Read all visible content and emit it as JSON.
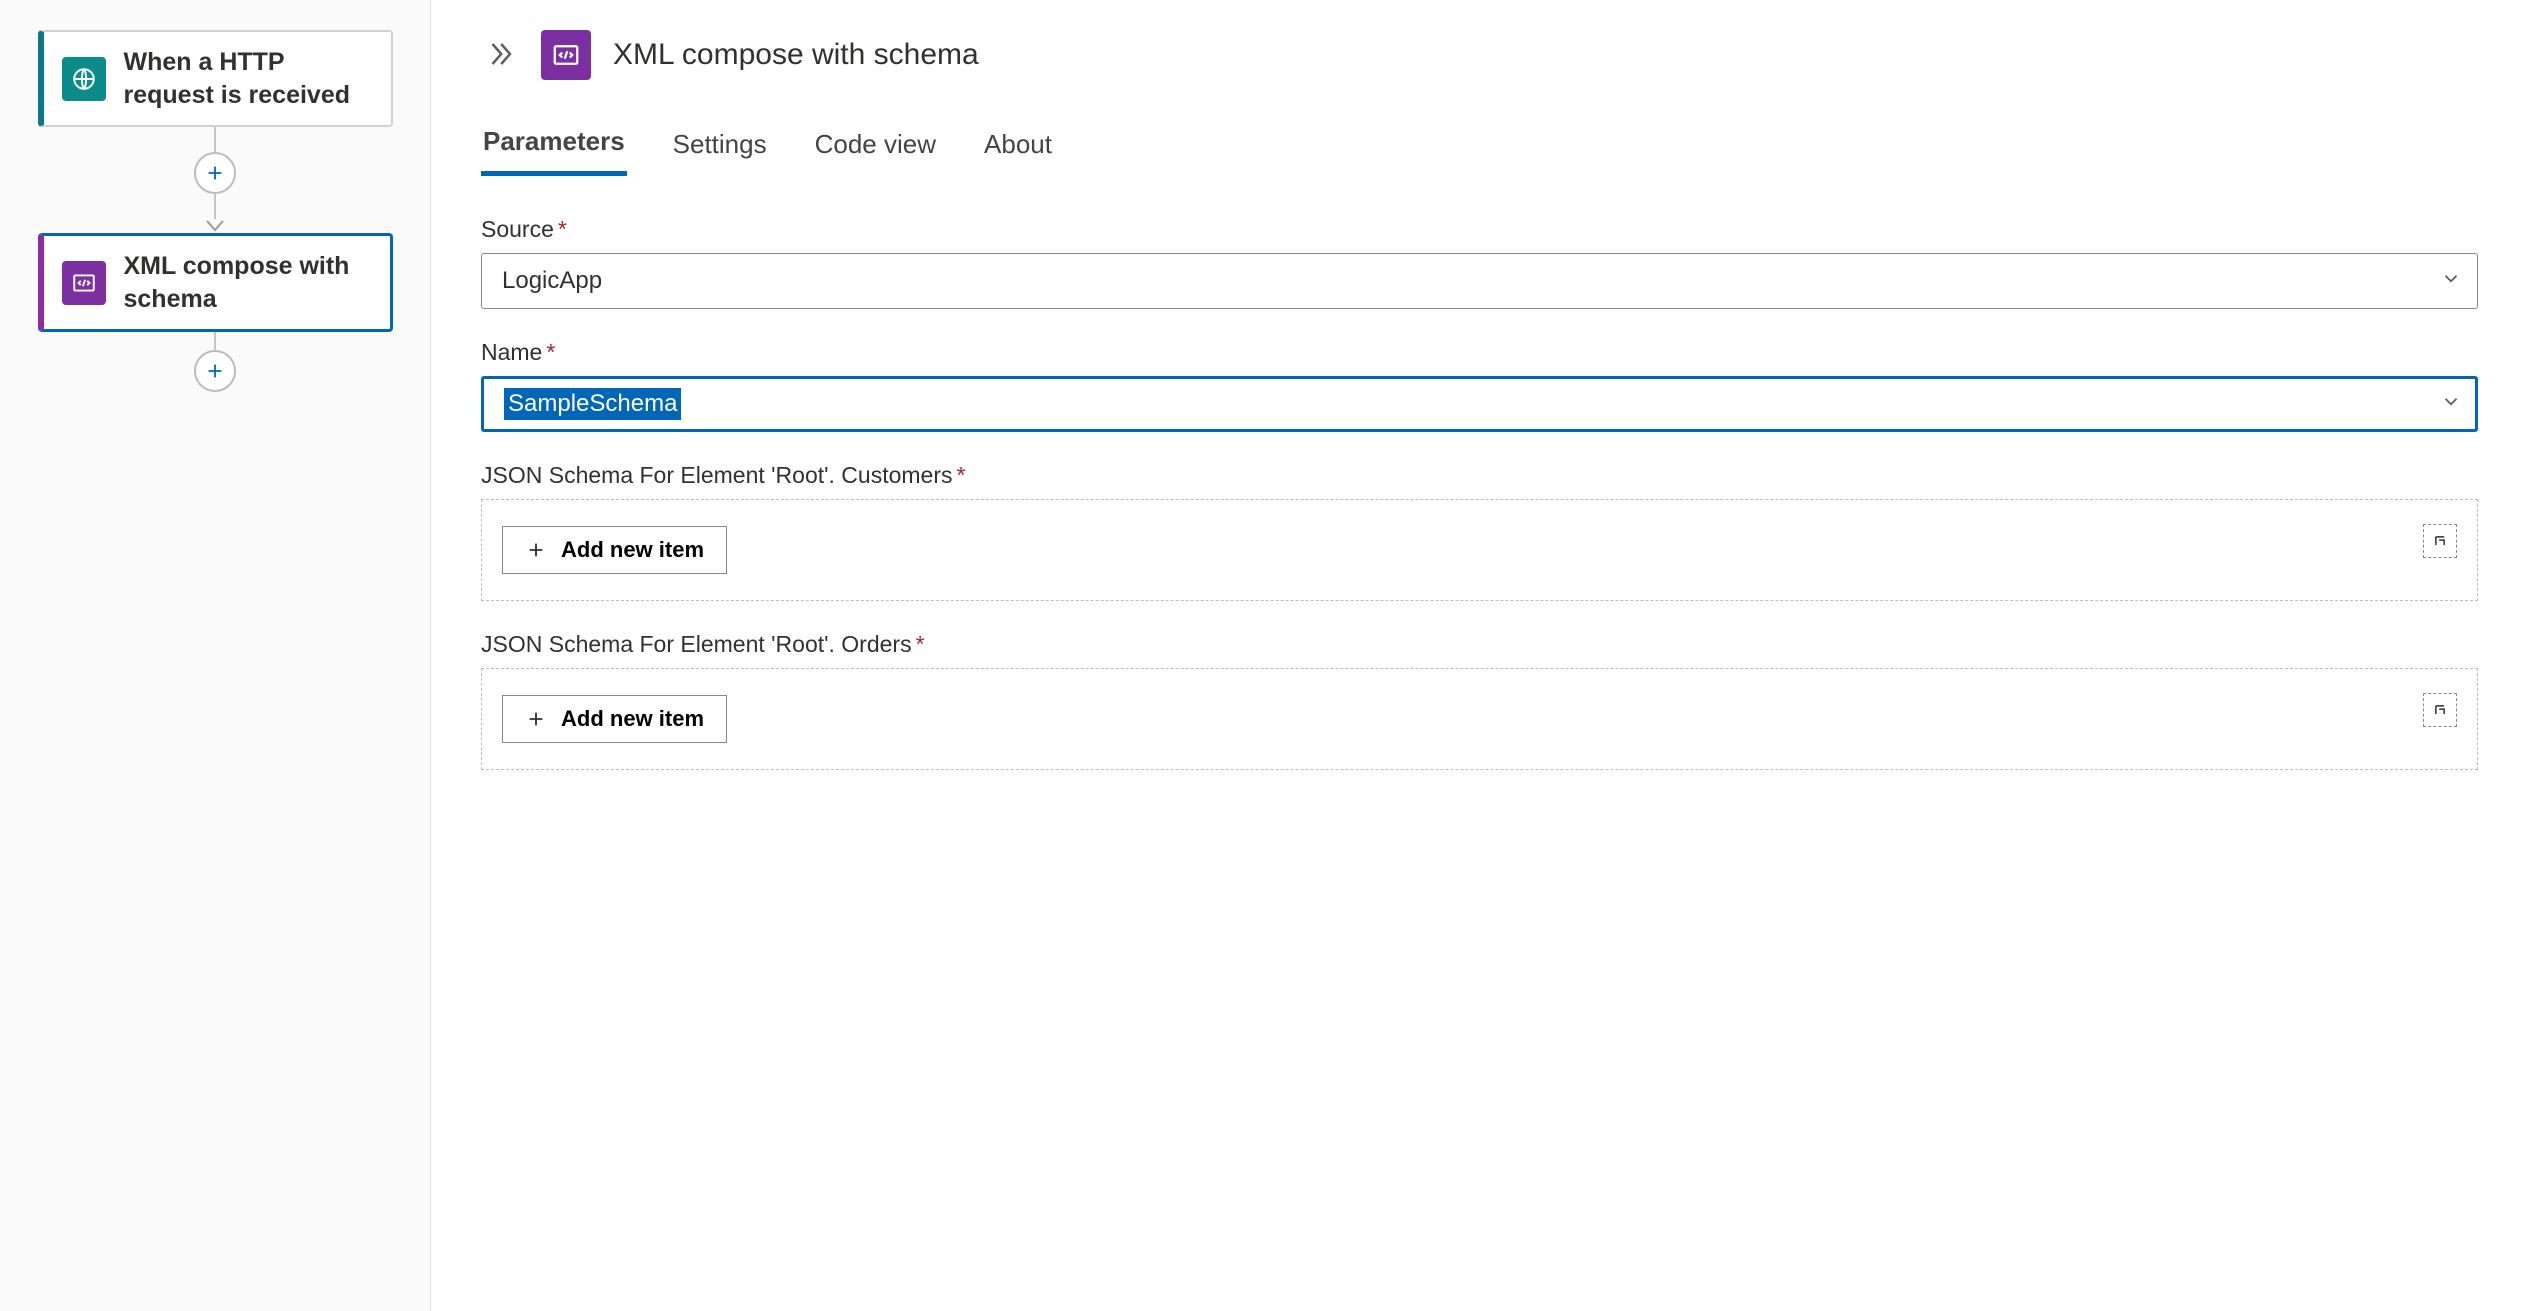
{
  "canvas": {
    "trigger": {
      "title": "When a HTTP request is received"
    },
    "action": {
      "title": "XML compose with schema"
    }
  },
  "panel": {
    "title": "XML compose with schema"
  },
  "tabs": {
    "parameters": "Parameters",
    "settings": "Settings",
    "codeview": "Code view",
    "about": "About"
  },
  "fields": {
    "source": {
      "label": "Source",
      "value": "LogicApp"
    },
    "name": {
      "label": "Name",
      "value": "SampleSchema"
    },
    "customers": {
      "label": "JSON Schema For Element 'Root'. Customers",
      "addLabel": "Add new item"
    },
    "orders": {
      "label": "JSON Schema For Element 'Root'. Orders",
      "addLabel": "Add new item"
    }
  }
}
